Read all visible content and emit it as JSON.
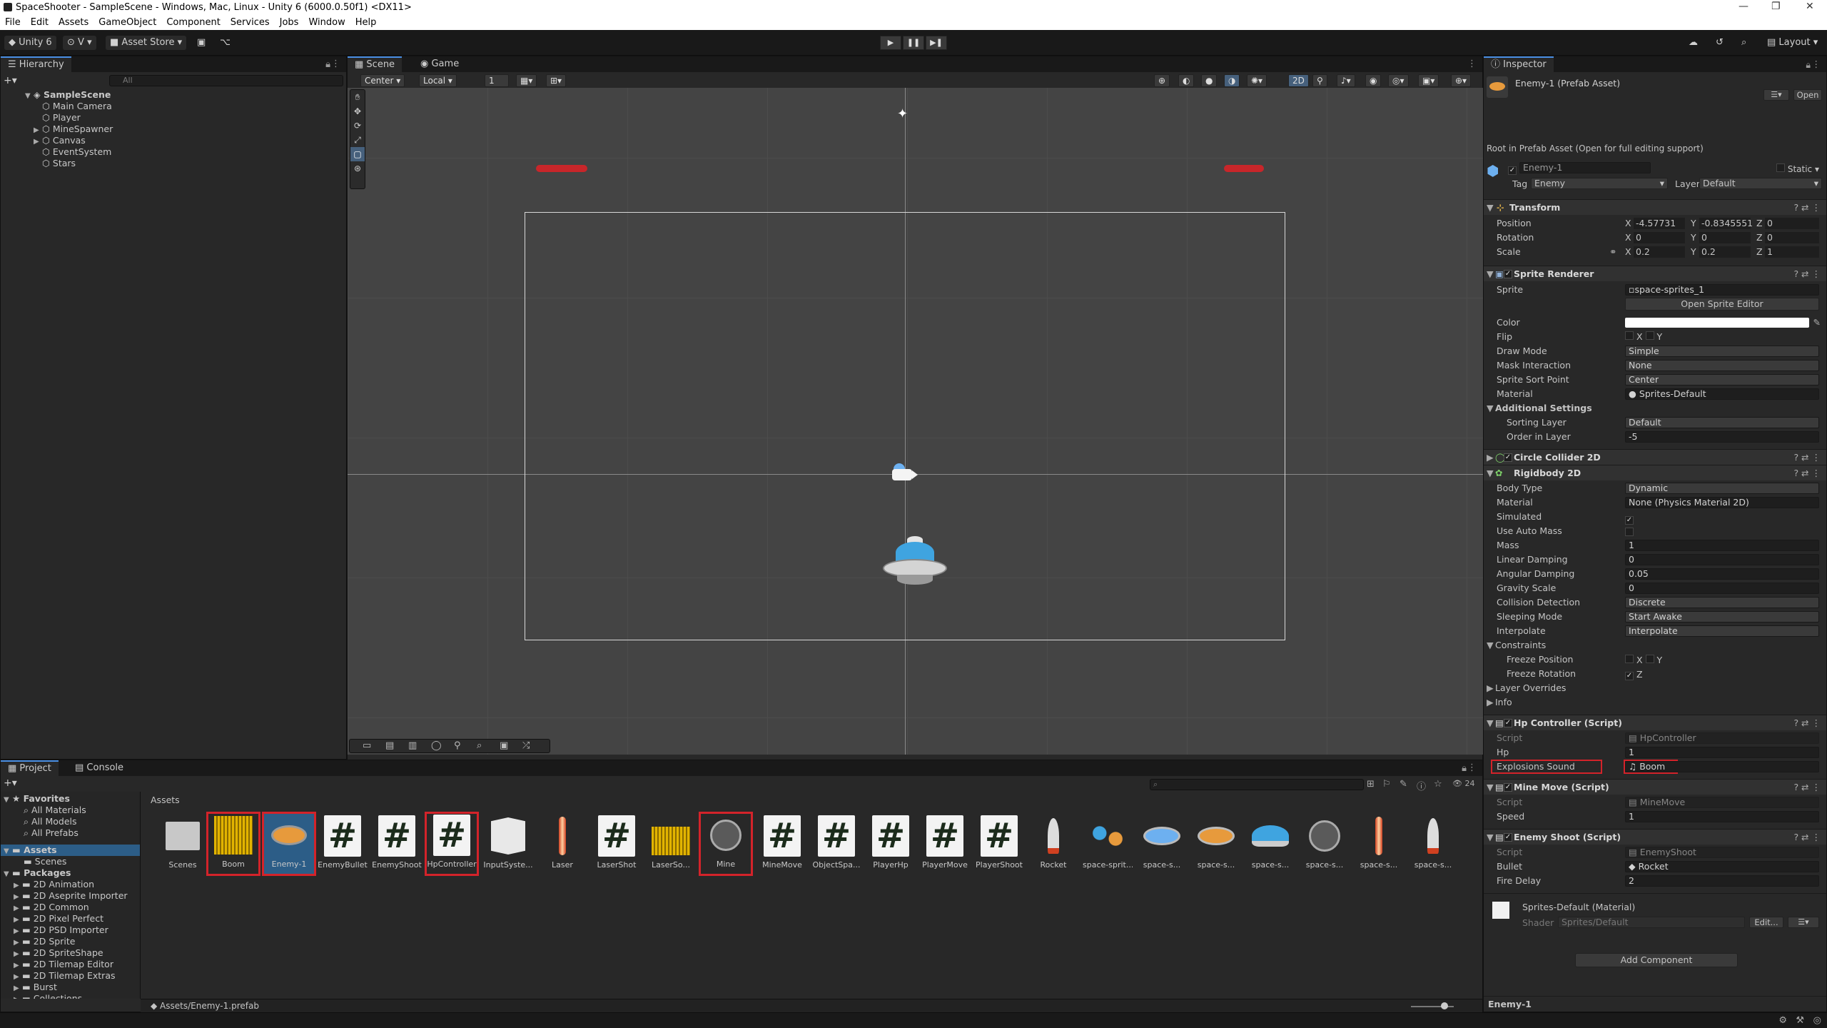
{
  "window": {
    "title": "SpaceShooter - SampleScene - Windows, Mac, Linux - Unity 6 (6000.0.50f1) <DX11>"
  },
  "menu": [
    "File",
    "Edit",
    "Assets",
    "GameObject",
    "Component",
    "Services",
    "Jobs",
    "Window",
    "Help"
  ],
  "toolbar": {
    "account": "Unity 6",
    "vcs": "V",
    "asset_store": "Asset Store",
    "layout": "Layout"
  },
  "hierarchy": {
    "tab": "Hierarchy",
    "search_placeholder": "All",
    "scene": "SampleScene",
    "items": [
      "Main Camera",
      "Player",
      "MineSpawner",
      "Canvas",
      "EventSystem",
      "Stars"
    ]
  },
  "scene": {
    "tabs": [
      "Scene",
      "Game"
    ],
    "pivot": "Center",
    "space": "Local",
    "snap": "1",
    "mode2d": "2D"
  },
  "inspector": {
    "tab": "Inspector",
    "object": "Enemy-1 (Prefab Asset)",
    "open": "Open",
    "root_note": "Root in Prefab Asset (Open for full editing support)",
    "name": "Enemy-1",
    "static": "Static",
    "tag_label": "Tag",
    "tag": "Enemy",
    "layer_label": "Layer",
    "layer": "Default",
    "transform": {
      "title": "Transform",
      "position": {
        "label": "Position",
        "x": "-4.57731",
        "y": "-0.8345551",
        "z": "0"
      },
      "rotation": {
        "label": "Rotation",
        "x": "0",
        "y": "0",
        "z": "0"
      },
      "scale": {
        "label": "Scale",
        "x": "0.2",
        "y": "0.2",
        "z": "1"
      }
    },
    "sprite_renderer": {
      "title": "Sprite Renderer",
      "sprite_label": "Sprite",
      "sprite": "space-sprites_1",
      "open_editor": "Open Sprite Editor",
      "color_label": "Color",
      "flip_label": "Flip",
      "flip_x": "X",
      "flip_y": "Y",
      "draw_mode_label": "Draw Mode",
      "draw_mode": "Simple",
      "mask_label": "Mask Interaction",
      "mask": "None",
      "sort_point_label": "Sprite Sort Point",
      "sort_point": "Center",
      "material_label": "Material",
      "material": "Sprites-Default",
      "additional": "Additional Settings",
      "sorting_layer_label": "Sorting Layer",
      "sorting_layer": "Default",
      "order_label": "Order in Layer",
      "order": "-5"
    },
    "circle_collider": {
      "title": "Circle Collider 2D"
    },
    "rigidbody": {
      "title": "Rigidbody 2D",
      "rows": [
        {
          "label": "Body Type",
          "value": "Dynamic"
        },
        {
          "label": "Material",
          "value": "None (Physics Material 2D)"
        },
        {
          "label": "Simulated",
          "value": "✓"
        },
        {
          "label": "Use Auto Mass",
          "value": ""
        },
        {
          "label": "Mass",
          "value": "1"
        },
        {
          "label": "Linear Damping",
          "value": "0"
        },
        {
          "label": "Angular Damping",
          "value": "0.05"
        },
        {
          "label": "Gravity Scale",
          "value": "0"
        },
        {
          "label": "Collision Detection",
          "value": "Discrete"
        },
        {
          "label": "Sleeping Mode",
          "value": "Start Awake"
        },
        {
          "label": "Interpolate",
          "value": "Interpolate"
        }
      ],
      "constraints": "Constraints",
      "freeze_pos": "Freeze Position",
      "freeze_rot": "Freeze Rotation",
      "x": "X",
      "y": "Y",
      "z": "Z",
      "layer_overrides": "Layer Overrides",
      "info": "Info"
    },
    "hp_controller": {
      "title": "Hp Controller (Script)",
      "script_label": "Script",
      "script": "HpController",
      "hp_label": "Hp",
      "hp": "1",
      "sound_label": "Explosions Sound",
      "sound": "Boom"
    },
    "mine_move": {
      "title": "Mine Move (Script)",
      "script_label": "Script",
      "script": "MineMove",
      "speed_label": "Speed",
      "speed": "1"
    },
    "enemy_shoot": {
      "title": "Enemy Shoot (Script)",
      "script_label": "Script",
      "script": "EnemyShoot",
      "bullet_label": "Bullet",
      "bullet": "Rocket",
      "delay_label": "Fire Delay",
      "delay": "2"
    },
    "material_section": {
      "name": "Sprites-Default (Material)",
      "shader_label": "Shader",
      "shader": "Sprites/Default",
      "edit": "Edit..."
    },
    "add_component": "Add Component",
    "footer": "Enemy-1"
  },
  "project": {
    "tabs": [
      "Project",
      "Console"
    ],
    "breadcrumb": "Assets",
    "count": "24",
    "favorites": {
      "label": "Favorites",
      "items": [
        "All Materials",
        "All Models",
        "All Prefabs"
      ]
    },
    "assets_label": "Assets",
    "scenes": "Scenes",
    "packages_label": "Packages",
    "packages": [
      "2D Animation",
      "2D Aseprite Importer",
      "2D Common",
      "2D Pixel Perfect",
      "2D PSD Importer",
      "2D Sprite",
      "2D SpriteShape",
      "2D Tilemap Editor",
      "2D Tilemap Extras",
      "Burst",
      "Collections"
    ],
    "assets": [
      "Scenes",
      "Boom",
      "Enemy-1",
      "EnemyBullet",
      "EnemyShoot",
      "HpController",
      "InputSyste...",
      "Laser",
      "LaserShot",
      "LaserSo...",
      "Mine",
      "MineMove",
      "ObjectSpa...",
      "PlayerHp",
      "PlayerMove",
      "PlayerShoot",
      "Rocket",
      "space-sprit...",
      "space-s...",
      "space-s...",
      "space-s...",
      "space-s...",
      "space-s...",
      "space-s..."
    ],
    "path": "Assets/Enemy-1.prefab"
  }
}
